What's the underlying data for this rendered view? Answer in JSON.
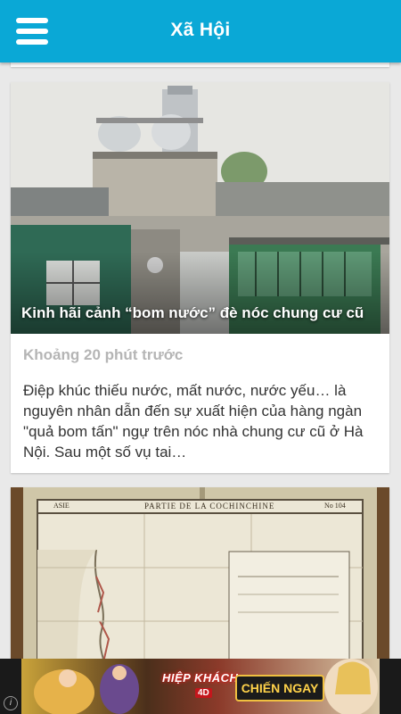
{
  "appbar": {
    "title": "Xã Hội",
    "menu_icon": "hamburger-menu-icon",
    "background_color": "#0aa8d6"
  },
  "articles": [
    {
      "title": "Kinh hãi cảnh “bom nước” đè nóc chung cư cũ",
      "time": "Khoảng 20 phút trước",
      "summary": "Điệp khúc thiếu nước, mất nước, nước yếu… là nguyên nhân dẫn đến sự xuất hiện của hàng ngàn \"quả bom tấn\" ngự trên nóc nhà chung cư cũ ở Hà Nội. Sau một số vụ tai…"
    },
    {
      "map_header": "PARTIE DE LA COCHINCHINE",
      "map_label_left": "ASIE",
      "map_label_right": "No 104"
    }
  ],
  "ad": {
    "cta_label": "CHIẾN NGAY",
    "logo_text": "HIỆP KHÁCH",
    "logo_sub": "4D",
    "info_icon": "info-icon"
  }
}
